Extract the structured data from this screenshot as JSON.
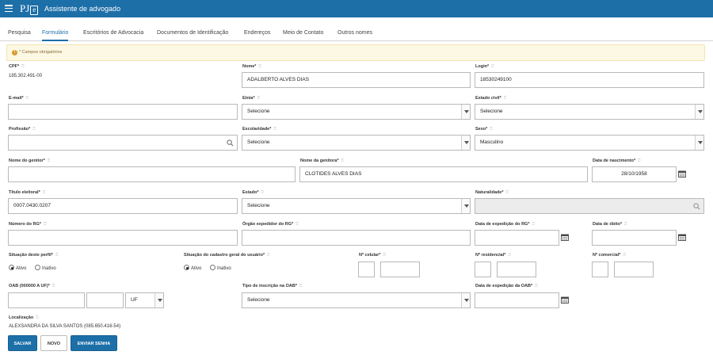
{
  "header": {
    "brand_pj": "PJ",
    "brand_e": "e",
    "title": "Assistente de advogado"
  },
  "tabs": [
    "Pesquisa",
    "Formulário",
    "Escritórios de Advocacia",
    "Documentos de Identificação",
    "Endereços",
    "Meio de Contato",
    "Outros nomes"
  ],
  "active_tab": "Formulário",
  "alert": {
    "icon": "exclamation-icon",
    "text": "* Campos obrigatórios"
  },
  "hint": "⍰",
  "fields": {
    "cpf": {
      "label": "CPF*",
      "value": "185.302.491-00"
    },
    "nome": {
      "label": "Nome*",
      "value": "ADALBERTO ALVES DIAS"
    },
    "login": {
      "label": "Login*",
      "value": "18530249100"
    },
    "email": {
      "label": "E-mail*",
      "value": ""
    },
    "etnia": {
      "label": "Etnia*",
      "value": "Selecione"
    },
    "estado_civil": {
      "label": "Estado civil*",
      "value": "Selecione"
    },
    "profissao": {
      "label": "Profissão*",
      "value": ""
    },
    "escolaridade": {
      "label": "Escolaridade*",
      "value": "Selecione"
    },
    "sexo": {
      "label": "Sexo*",
      "value": "Masculino"
    },
    "nome_genitor": {
      "label": "Nome do genitor*",
      "value": ""
    },
    "nome_genitora": {
      "label": "Nome da genitora*",
      "value": "CLOTIDES ALVES DIAS"
    },
    "data_nascimento": {
      "label": "Data de nascimento*",
      "value": "28/10/1958"
    },
    "titulo_eleitoral": {
      "label": "Título eleitoral*",
      "value": "0007.0430.0207"
    },
    "estado": {
      "label": "Estado*",
      "value": "Selecione"
    },
    "naturalidade": {
      "label": "Naturalidade*",
      "value": ""
    },
    "numero_rg": {
      "label": "Número do RG*",
      "value": ""
    },
    "orgao_rg": {
      "label": "Órgão expedidor do RG*",
      "value": ""
    },
    "data_exp_rg": {
      "label": "Data de expedição do RG*",
      "value": ""
    },
    "data_obito": {
      "label": "Data de óbito*",
      "value": ""
    },
    "situacao_perfil": {
      "label": "Situação deste perfil*",
      "options": [
        "Ativo",
        "Inativo"
      ],
      "selected": "Ativo"
    },
    "situacao_cadastro": {
      "label": "Situação do cadastro geral do usuário*",
      "options": [
        "Ativo",
        "Inativo"
      ],
      "selected": "Ativo"
    },
    "celular": {
      "label": "Nº celular*",
      "ddd": "",
      "number": ""
    },
    "residencial": {
      "label": "Nº residencial*",
      "ddd": "",
      "number": ""
    },
    "comercial": {
      "label": "Nº comercial*",
      "ddd": "",
      "number": ""
    },
    "oab": {
      "label": "OAB (000000 A UF)*",
      "number": "",
      "letter": "",
      "uf": "UF"
    },
    "tipo_inscricao": {
      "label": "Tipo de inscrição na OAB*",
      "value": "Selecione"
    },
    "data_exp_oab": {
      "label": "Data de expedição da OAB*",
      "value": ""
    },
    "localizacao": {
      "label": "Localização",
      "value": "ALEXSANDRA DA SILVA SANTOS (085.650.416-54)"
    }
  },
  "buttons": {
    "salvar": "SALVAR",
    "novo": "NOVO",
    "enviar_senha": "ENVIAR SENHA"
  },
  "colors": {
    "primary": "#1d6fa8",
    "alert_bg": "#fcf8e3",
    "alert_text": "#8a6d3b"
  }
}
